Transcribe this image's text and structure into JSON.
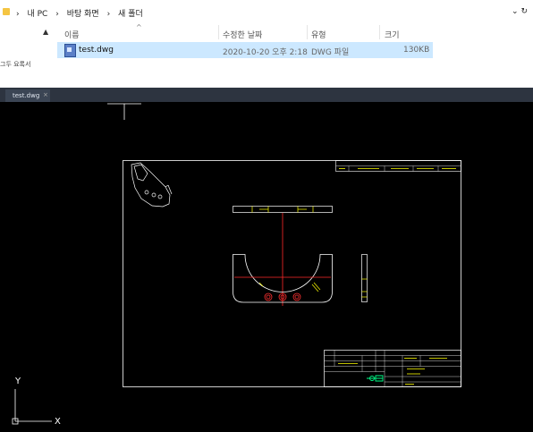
{
  "explorer": {
    "breadcrumb": [
      "›",
      "내 PC",
      "›",
      "바탕 화면",
      "›",
      "새 폴더"
    ],
    "address_right": "⌄ ↻",
    "nav_label": "그두 요록서",
    "columns": {
      "name": "이름",
      "date": "수정한 날짜",
      "type": "유형",
      "size": "크기"
    },
    "file": {
      "name": "test.dwg",
      "date": "2020-10-20 오후 2:18",
      "type": "DWG 파일",
      "size": "130KB"
    }
  },
  "cad": {
    "tab_label": "test.dwg",
    "tab_close": "×",
    "ucs": {
      "y": "Y",
      "x": "X"
    },
    "colors": {
      "background": "#000000",
      "frame": "#ffffff",
      "centerline": "#ff2a2a",
      "dimension": "#ffff00"
    }
  }
}
